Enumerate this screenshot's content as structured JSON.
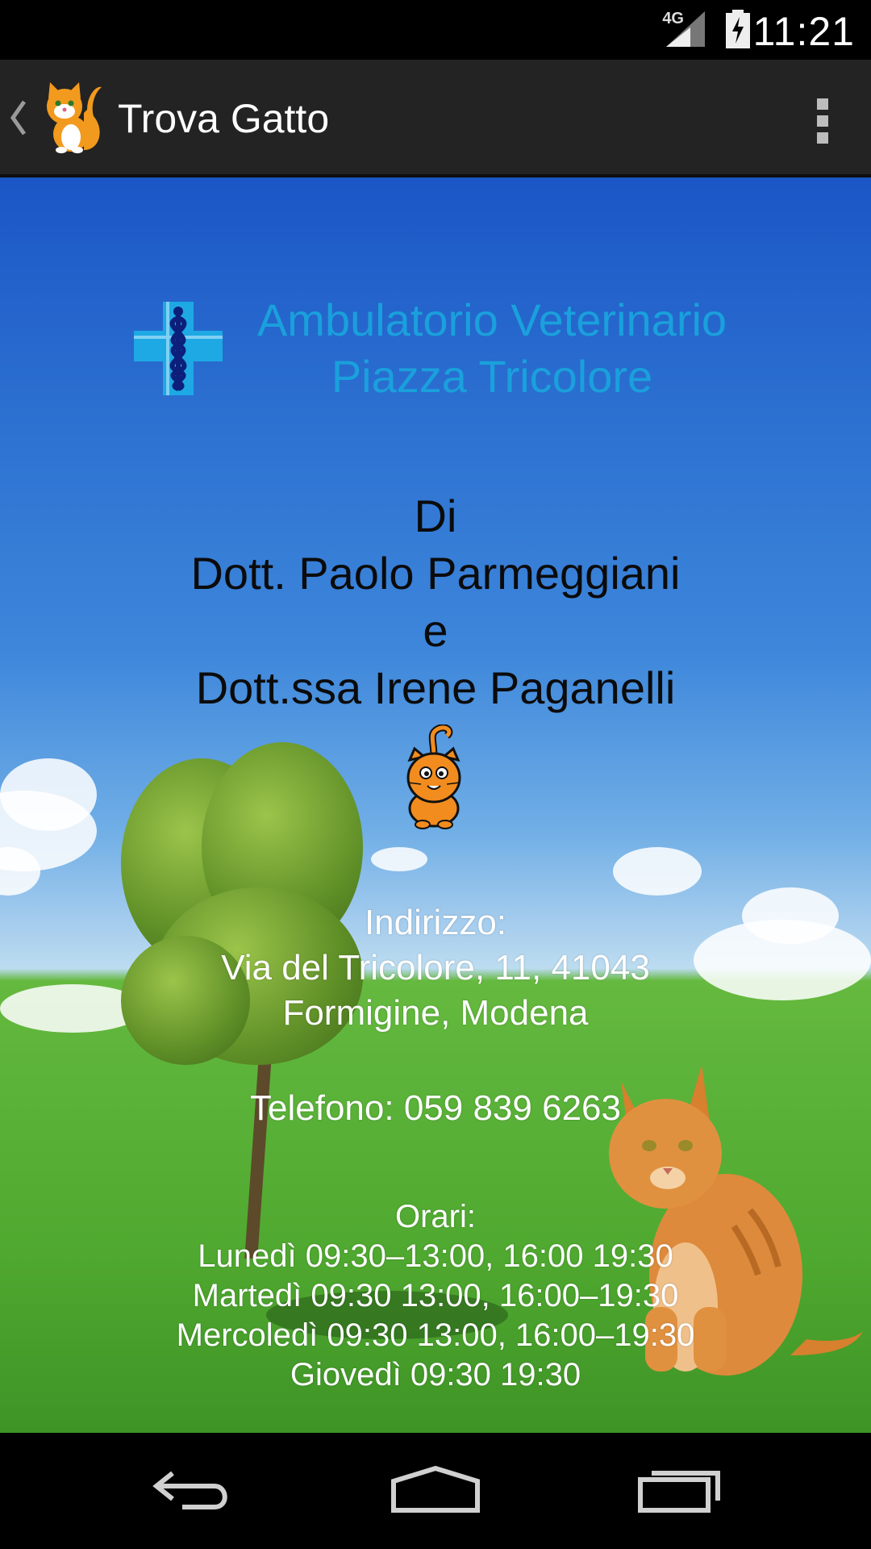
{
  "status_bar": {
    "network": "4G",
    "time": "11:21"
  },
  "action_bar": {
    "title": "Trova Gatto"
  },
  "clinic": {
    "name_line1": "Ambulatorio Veterinario",
    "name_line2": "Piazza Tricolore"
  },
  "doctors": {
    "line1": "Di",
    "line2": "Dott. Paolo Parmeggiani",
    "line3": "e",
    "line4": "Dott.ssa Irene Paganelli"
  },
  "address": {
    "label": "Indirizzo:",
    "line1": "Via del Tricolore, 11, 41043",
    "line2": "Formigine, Modena"
  },
  "phone": {
    "text": "Telefono: 059 839 6263"
  },
  "hours": {
    "label": "Orari:",
    "monday": "Lunedì 09:30–13:00, 16:00 19:30",
    "tuesday": "Martedì 09:30 13:00, 16:00–19:30",
    "wednesday": "Mercoledì 09:30 13:00, 16:00–19:30",
    "thursday": "Giovedì 09:30 19:30"
  },
  "colors": {
    "clinic_name": "#1aa0dc",
    "action_bar_bg": "#232323",
    "status_bar_bg": "#000000"
  },
  "icons": {
    "back": "chevron-left-icon",
    "app": "cat-icon",
    "overflow": "overflow-menu-icon",
    "nav_back": "back-arrow-icon",
    "nav_home": "home-icon",
    "nav_recents": "recents-icon"
  }
}
